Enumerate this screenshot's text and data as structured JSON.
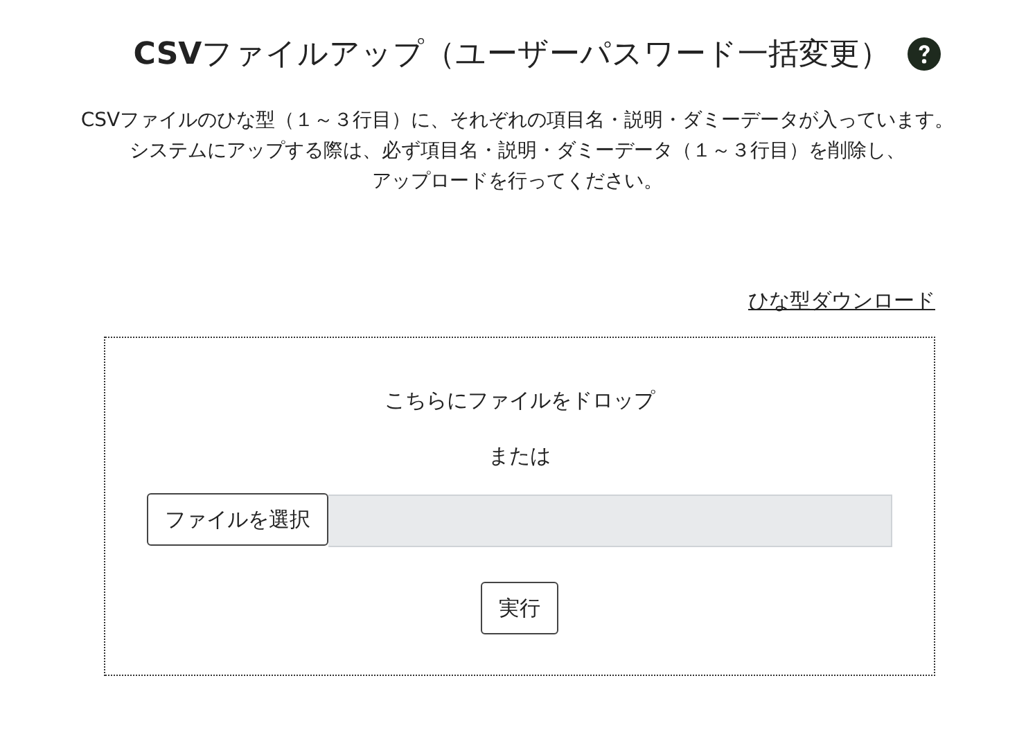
{
  "title": "**CSV**ファイルアップ（ユーザーパスワード一括変更）",
  "description_lines": [
    "CSVファイルのひな型（１～３行目）に、それぞれの項目名・説明・ダミーデータが入っています。",
    "システムにアップする際は、必ず項目名・説明・ダミーデータ（１～３行目）を削除し、",
    "アップロードを行ってください。"
  ],
  "template_link": "ひな型ダウンロード",
  "dropzone": {
    "prompt": "こちらにファイルをドロップ",
    "or": "または",
    "choose_button": "ファイルを選択",
    "submit_button": "実行"
  }
}
